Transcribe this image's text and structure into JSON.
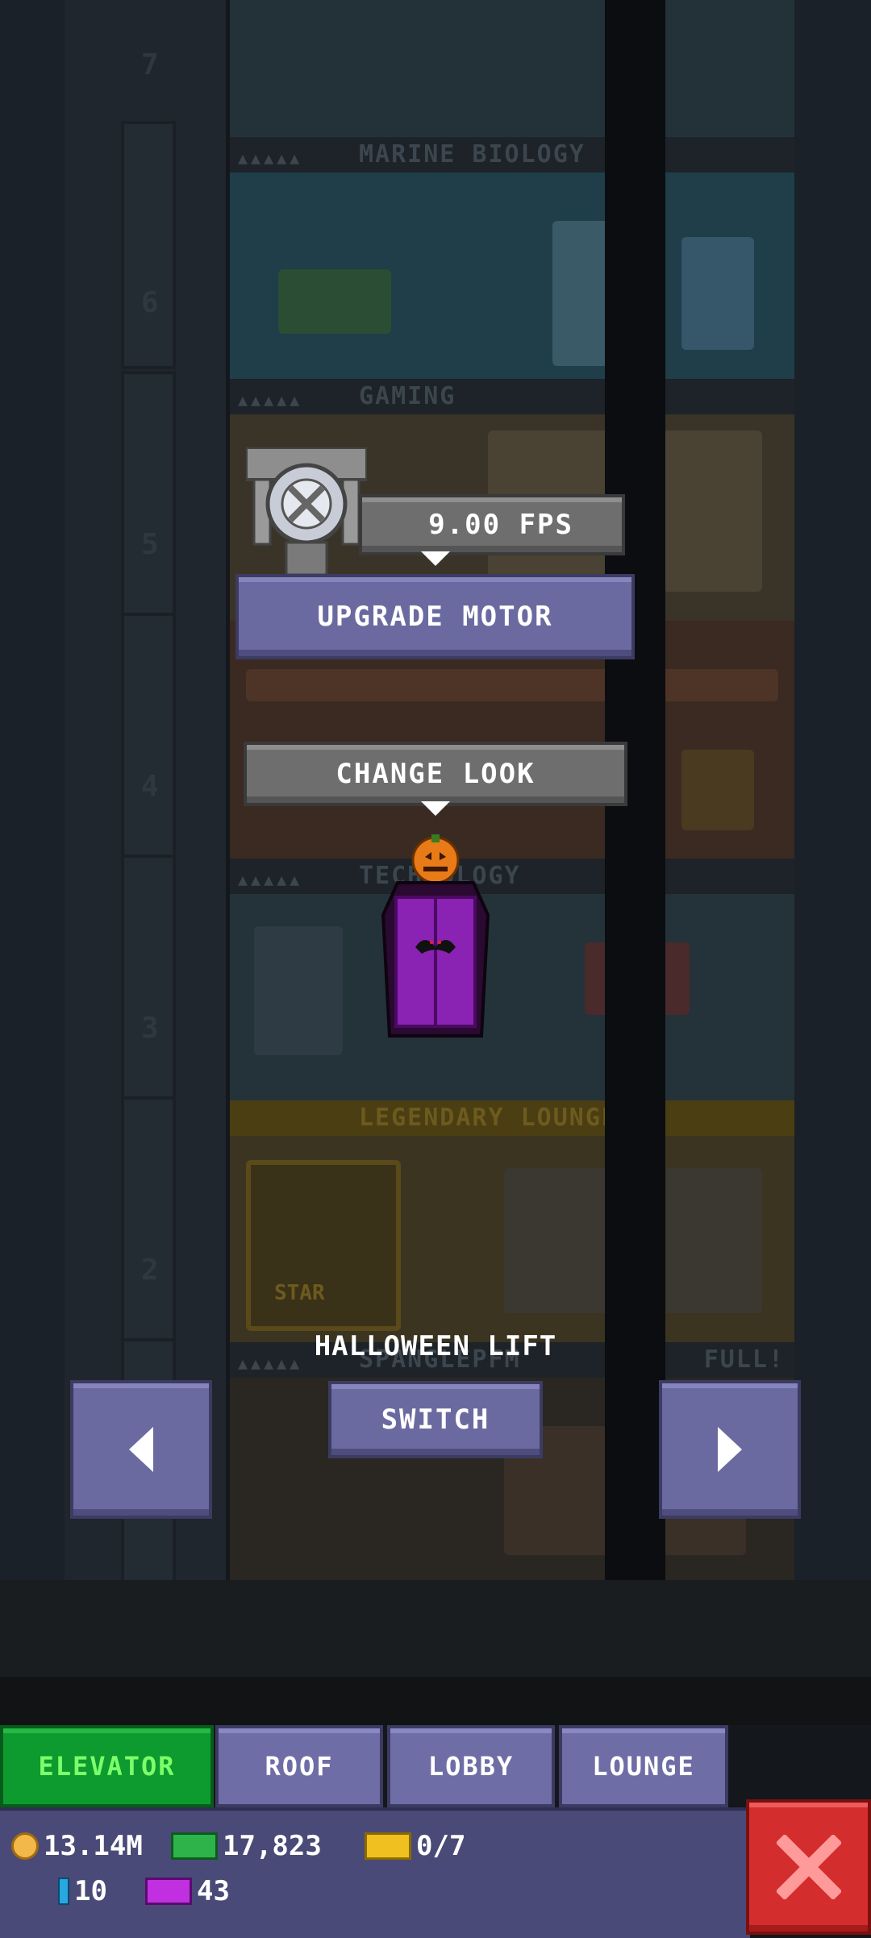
{
  "floors": {
    "marine_biology": "MARINE BIOLOGY",
    "gaming": "GAMING",
    "technology": "TECHNOLOGY",
    "legendary_lounge": "LEGENDARY LOUNGE",
    "bottom_floor": "SPANGLEPFM",
    "bottom_status": "FULL!",
    "star_sign": "STAR"
  },
  "floor_numbers": [
    "7",
    "6",
    "5",
    "4",
    "3",
    "2"
  ],
  "elevator": {
    "speed": "9.00 FPS",
    "upgrade_label": "UPGRADE MOTOR",
    "change_look_label": "CHANGE LOOK",
    "lift_name": "HALLOWEEN LIFT",
    "switch_label": "SWITCH"
  },
  "tabs": [
    {
      "label": "ELEVATOR",
      "active": true
    },
    {
      "label": "ROOF",
      "active": false
    },
    {
      "label": "LOBBY",
      "active": false
    },
    {
      "label": "LOUNGE",
      "active": false
    }
  ],
  "status": {
    "coins": "13.14M",
    "bux": "17,823",
    "tickets": "0/7",
    "keys": "10",
    "vip_tickets": "43"
  },
  "colors": {
    "active_tab": "#0d9a2e",
    "button_purple": "#6b6aa0",
    "close_red": "#d42d2d"
  },
  "icons": {
    "prev": "arrow-left-icon",
    "next": "arrow-right-icon",
    "close": "close-x-icon",
    "motor": "motor-fan-icon",
    "coin": "coin-icon",
    "bux": "bux-icon",
    "ticket": "golden-ticket-icon",
    "key": "key-icon",
    "vip": "vip-ticket-icon"
  }
}
